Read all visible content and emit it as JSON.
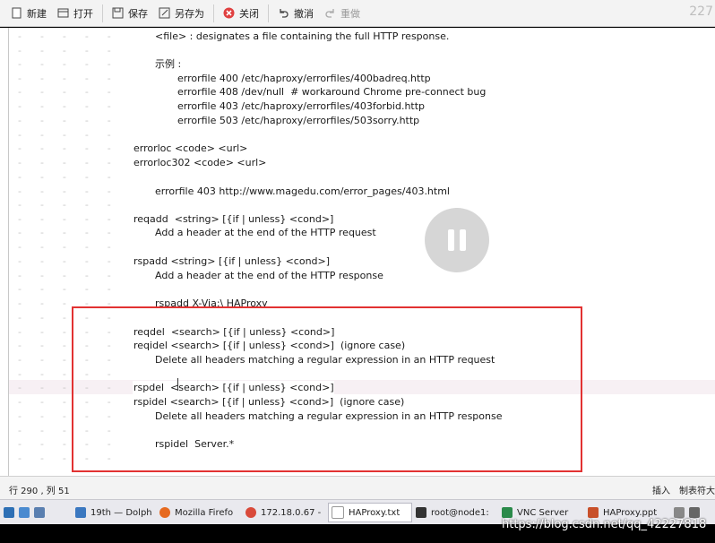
{
  "toolbar": {
    "new_label": "新建",
    "open_label": "打开",
    "save_label": "保存",
    "save_as_label": "另存为",
    "close_label": "关闭",
    "undo_label": "撤消",
    "redo_label": "重做",
    "corner_number": "227"
  },
  "editor": {
    "lines": [
      "<file> : designates a file containing the full HTTP response.",
      "",
      "示例 :",
      "errorfile 400 /etc/haproxy/errorfiles/400badreq.http",
      "errorfile 408 /dev/null  # workaround Chrome pre-connect bug",
      "errorfile 403 /etc/haproxy/errorfiles/403forbid.http",
      "errorfile 503 /etc/haproxy/errorfiles/503sorry.http",
      "",
      "errorloc <code> <url>",
      "errorloc302 <code> <url>",
      "",
      "errorfile 403 http://www.magedu.com/error_pages/403.html",
      "",
      "reqadd  <string> [{if | unless} <cond>]",
      "Add a header at the end of the HTTP request",
      "",
      "rspadd <string> [{if | unless} <cond>]",
      "Add a header at the end of the HTTP response",
      "",
      "rspadd X-Via:\\ HAProxy",
      "",
      "reqdel  <search> [{if | unless} <cond>]",
      "reqidel <search> [{if | unless} <cond>]  (ignore case)",
      "Delete all headers matching a regular expression in an HTTP request",
      "",
      "rspdel  <search> [{if | unless} <cond>]",
      "rspidel <search> [{if | unless} <cond>]  (ignore case)",
      "Delete all headers matching a regular expression in an HTTP response",
      "",
      "rspidel  Server.*",
      ""
    ]
  },
  "status": {
    "position": "行 290 , 列 51",
    "mode": "插入",
    "tab": "制表符大"
  },
  "taskbar": {
    "items": [
      "19th — Dolph",
      "Mozilla Firefo",
      "172.18.0.67 -",
      "HAProxy.txt",
      "root@node1:",
      "VNC Server",
      "HAProxy.ppt"
    ]
  },
  "watermark": "https://blog.csdn.net/qq_42227818"
}
